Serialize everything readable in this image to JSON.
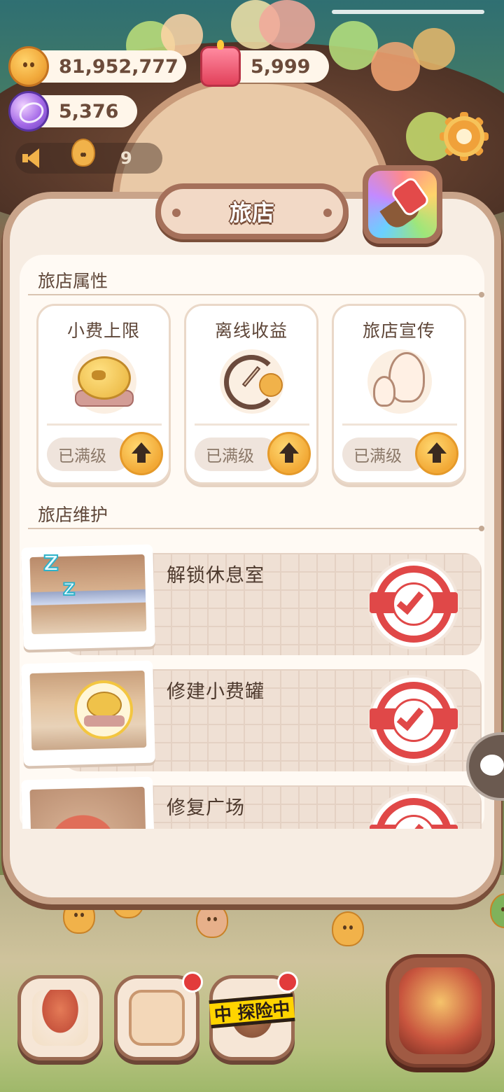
{
  "currency": {
    "cookies": "81,952,777",
    "candles": "5,999",
    "gems": "5,376"
  },
  "speaker": {
    "count": "9"
  },
  "panel": {
    "title": "旅店"
  },
  "attributes": {
    "section_title": "旅店属性",
    "cards": [
      {
        "name": "小费上限",
        "status": "已满级",
        "icon": "tip-jar-pig-icon"
      },
      {
        "name": "离线收益",
        "status": "已满级",
        "icon": "offline-clock-icon"
      },
      {
        "name": "旅店宣传",
        "status": "已满级",
        "icon": "promotion-ghosts-icon"
      }
    ]
  },
  "maintenance": {
    "section_title": "旅店维护",
    "items": [
      {
        "label": "解锁休息室",
        "completed": true
      },
      {
        "label": "修建小费罐",
        "completed": true
      },
      {
        "label": "修复广场",
        "completed": true
      }
    ]
  },
  "bottom_nav": {
    "explore_tag": "中 探险中"
  },
  "colors": {
    "panel_border": "#a5705a",
    "upgrade_button": "#f2a936",
    "stamp_red": "#e04848"
  }
}
